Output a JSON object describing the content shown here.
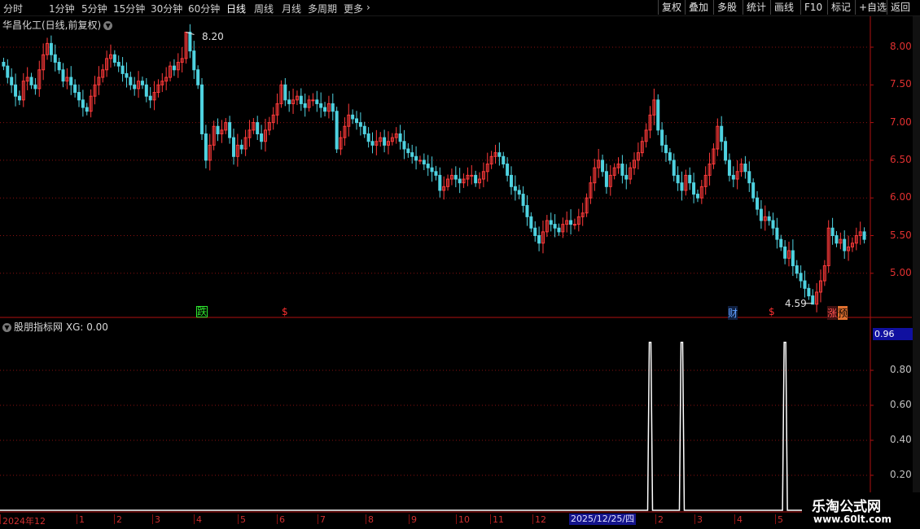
{
  "toolbar": {
    "periods": [
      "分时",
      "1分钟",
      "5分钟",
      "15分钟",
      "30分钟",
      "60分钟",
      "日线",
      "周线",
      "月线",
      "多周期",
      "更多"
    ],
    "more_arrow": "›",
    "tools": [
      "复权",
      "叠加",
      "多股",
      "统计",
      "画线",
      "F10",
      "标记",
      "+自选",
      "返回"
    ]
  },
  "main_chart": {
    "title": "华昌化工(日线,前复权)",
    "high_label": "8.20",
    "low_label": "4.59",
    "y_ticks": [
      "8.00",
      "7.50",
      "7.00",
      "6.50",
      "6.00",
      "5.50",
      "5.00"
    ],
    "event_tags": [
      {
        "text": "跌",
        "color": "#2ee62e"
      },
      {
        "text": "$",
        "color": "#ff3030"
      },
      {
        "text": "财",
        "color": "#60a0ff"
      },
      {
        "text": "$",
        "color": "#ff3030"
      },
      {
        "text": "涨",
        "color": "#ff5050"
      },
      {
        "text": "预",
        "color": "#ff8040"
      }
    ]
  },
  "indicator": {
    "title": "股朋指标网",
    "value_text": "XG: 0.00",
    "current_value": "0.96",
    "y_ticks": [
      "0.80",
      "0.60",
      "0.40",
      "0.20"
    ]
  },
  "dates": {
    "start": "2024年12",
    "months": [
      "1",
      "2",
      "3",
      "4",
      "5",
      "6",
      "7",
      "8",
      "9",
      "10",
      "11",
      "12",
      "1",
      "2",
      "3",
      "4",
      "5",
      "6"
    ],
    "cursor_date": "2025/12/25/四"
  },
  "watermark": {
    "title": "乐淘公式网",
    "url": "www.60lt.com"
  },
  "colors": {
    "up": "#ff3a3a",
    "down": "#4fd2e0",
    "grid": "#8a1010",
    "background": "#000000"
  },
  "chart_data": {
    "type": "candlestick",
    "price_series": [
      7.75,
      7.6,
      7.5,
      7.35,
      7.3,
      7.55,
      7.6,
      7.5,
      7.45,
      7.7,
      7.9,
      8.05,
      7.9,
      7.8,
      7.7,
      7.55,
      7.6,
      7.5,
      7.4,
      7.3,
      7.2,
      7.15,
      7.35,
      7.5,
      7.6,
      7.7,
      7.85,
      7.9,
      7.8,
      7.75,
      7.65,
      7.6,
      7.5,
      7.45,
      7.55,
      7.5,
      7.35,
      7.3,
      7.4,
      7.5,
      7.55,
      7.6,
      7.75,
      7.7,
      7.8,
      7.85,
      8.2,
      7.95,
      7.7,
      7.5,
      6.85,
      6.5,
      6.7,
      6.95,
      6.85,
      6.9,
      7.0,
      6.8,
      6.55,
      6.7,
      6.65,
      6.8,
      6.9,
      7.0,
      6.85,
      6.75,
      6.9,
      7.0,
      7.1,
      7.25,
      7.5,
      7.3,
      7.25,
      7.3,
      7.35,
      7.25,
      7.2,
      7.3,
      7.3,
      7.25,
      7.2,
      7.15,
      7.25,
      7.15,
      6.65,
      6.8,
      6.95,
      7.1,
      7.05,
      7.0,
      6.95,
      6.85,
      6.75,
      6.7,
      6.75,
      6.8,
      6.7,
      6.75,
      6.8,
      6.85,
      6.75,
      6.65,
      6.6,
      6.55,
      6.5,
      6.5,
      6.45,
      6.4,
      6.35,
      6.3,
      6.1,
      6.15,
      6.25,
      6.3,
      6.25,
      6.2,
      6.25,
      6.3,
      6.3,
      6.2,
      6.25,
      6.35,
      6.45,
      6.55,
      6.6,
      6.55,
      6.45,
      6.3,
      6.15,
      6.1,
      6.05,
      5.9,
      5.75,
      5.6,
      5.5,
      5.4,
      5.55,
      5.7,
      5.65,
      5.6,
      5.55,
      5.65,
      5.7,
      5.65,
      5.65,
      5.75,
      5.8,
      6.0,
      6.2,
      6.4,
      6.5,
      6.35,
      6.15,
      6.3,
      6.4,
      6.45,
      6.3,
      6.25,
      6.4,
      6.5,
      6.6,
      6.75,
      6.9,
      7.1,
      7.3,
      6.9,
      6.7,
      6.6,
      6.5,
      6.3,
      6.2,
      6.1,
      6.3,
      6.2,
      6.05,
      6.0,
      6.15,
      6.3,
      6.45,
      6.65,
      6.95,
      6.75,
      6.5,
      6.3,
      6.25,
      6.35,
      6.45,
      6.35,
      6.2,
      6.0,
      5.85,
      5.7,
      5.75,
      5.7,
      5.6,
      5.45,
      5.35,
      5.2,
      5.3,
      5.1,
      5.0,
      4.9,
      4.8,
      4.7,
      4.59,
      4.75,
      4.9,
      5.1,
      5.6,
      5.5,
      5.4,
      5.45,
      5.3,
      5.35,
      5.4,
      5.5,
      5.55,
      5.45
    ],
    "price_range": [
      4.59,
      8.2
    ],
    "signal_bars": [
      163,
      171,
      197
    ],
    "signal_value": 0.96
  }
}
